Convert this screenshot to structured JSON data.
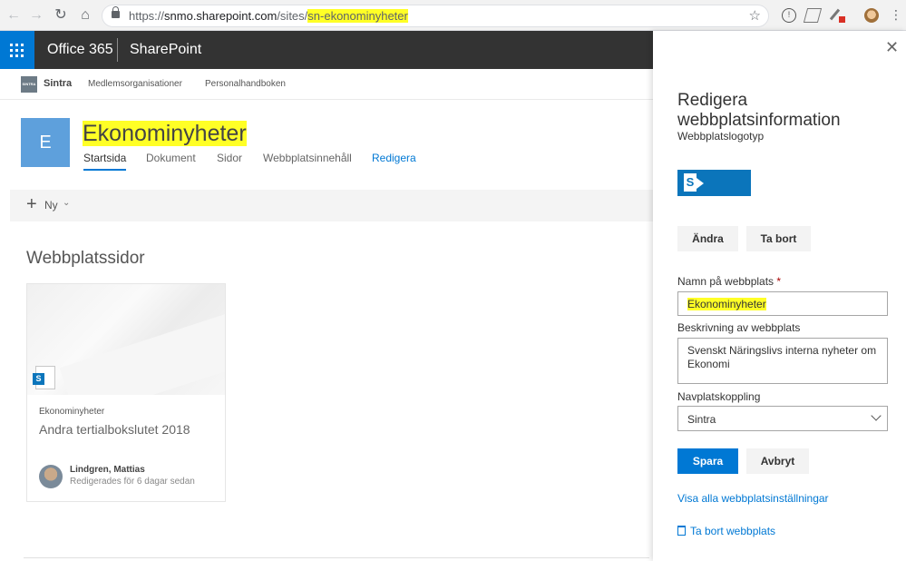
{
  "browser": {
    "url_prefix": "https://",
    "url_host": "snmo.sharepoint.com",
    "url_path": "/sites/",
    "url_highlight": "sn-ekonominyheter"
  },
  "suitebar": {
    "app": "Office 365",
    "product": "SharePoint"
  },
  "hubnav": {
    "logo_text": "SINTRA",
    "title": "Sintra",
    "links": [
      "Medlemsorganisationer",
      "Personalhandboken"
    ]
  },
  "site": {
    "logo_letter": "E",
    "title": "Ekonominyheter",
    "nav": [
      "Startsida",
      "Dokument",
      "Sidor",
      "Webbplatsinnehåll",
      "Redigera"
    ]
  },
  "commandbar": {
    "new_label": "Ny"
  },
  "main": {
    "section_title": "Webbplatssidor",
    "card": {
      "site": "Ekonominyheter",
      "title": "Andra tertialbokslutet 2018",
      "author": "Lindgren, Mattias",
      "edited": "Redigerades för 6 dagar sedan"
    }
  },
  "panel": {
    "title": "Redigera webbplatsinformation",
    "logo_label": "Webbplatslogotyp",
    "change_button": "Ändra",
    "remove_button": "Ta bort",
    "name_label": "Namn på webbplats",
    "name_required": "*",
    "name_value": "Ekonominyheter",
    "description_label": "Beskrivning av webbplats",
    "description_value": "Svenskt Näringslivs interna nyheter om Ekonomi",
    "navlink_label": "Navplatskoppling",
    "navlink_value": "Sintra",
    "save_button": "Spara",
    "cancel_button": "Avbryt",
    "all_settings_link": "Visa alla webbplatsinställningar",
    "delete_site_link": "Ta bort webbplats"
  },
  "colors": {
    "accent": "#0078d4",
    "suitebar": "#333333",
    "highlight": "#ffff26"
  }
}
